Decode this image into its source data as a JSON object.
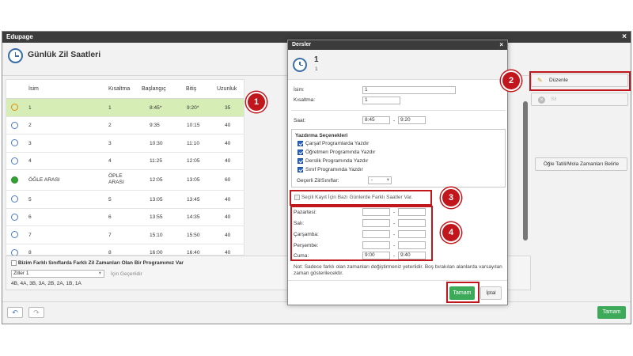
{
  "window": {
    "title": "Edupage",
    "close": "×"
  },
  "header": {
    "title": "Günlük Zil Saatleri"
  },
  "table": {
    "columns": [
      "İsim",
      "Kısaltma",
      "Başlangıç",
      "Bitiş",
      "Uzunluk"
    ],
    "rows": [
      {
        "name": "1",
        "short": "1",
        "start": "8:45*",
        "end": "9:20*",
        "len": "35"
      },
      {
        "name": "2",
        "short": "2",
        "start": "9:35",
        "end": "10:15",
        "len": "40"
      },
      {
        "name": "3",
        "short": "3",
        "start": "10:30",
        "end": "11:10",
        "len": "40"
      },
      {
        "name": "4",
        "short": "4",
        "start": "11:25",
        "end": "12:05",
        "len": "40"
      },
      {
        "name": "ÖĞLE ARASI",
        "short": "ÖPLE ARASI",
        "start": "12:05",
        "end": "13:05",
        "len": "60"
      },
      {
        "name": "5",
        "short": "5",
        "start": "13:05",
        "end": "13:45",
        "len": "40"
      },
      {
        "name": "6",
        "short": "6",
        "start": "13:55",
        "end": "14:35",
        "len": "40"
      },
      {
        "name": "7",
        "short": "7",
        "start": "15:10",
        "end": "15:50",
        "len": "40"
      },
      {
        "name": "8",
        "short": "8",
        "start": "16:00",
        "end": "16:40",
        "len": "40"
      }
    ]
  },
  "bottom_pane": {
    "checkbox_label": "Bizim Farklı Sınıflarda Farklı Zil Zamanları Olan Bir Programımız Var",
    "select_value": "Ziller 1",
    "valid_for": "İçin Geçerlidir",
    "classes": "4B, 4A, 3B, 3A, 2B, 2A, 1B, 1A"
  },
  "right_panel": {
    "edit_label": "Düzenle",
    "delete_label": "Sil",
    "lunch_label": "Öğle Tatili/Mola Zamanları Belirle"
  },
  "footer": {
    "ok_label": "Tamam",
    "undo_icon": "undo-icon",
    "redo_icon": "redo-icon"
  },
  "dialog": {
    "title": "Dersler",
    "close": "×",
    "head_title": "1",
    "head_sub": "1",
    "name_label": "İsim:",
    "name_value": "1",
    "short_label": "Kısaltma:",
    "short_value": "1",
    "time_label": "Saat:",
    "time_start": "8:45",
    "time_end": "9:20",
    "time_sep": "-",
    "print_title": "Yazdırma Seçenekleri",
    "print_options": [
      "Çarşaf Programlarda Yazdır",
      "Öğretmen Programında Yazdır",
      "Derslik Programında Yazdır",
      "Sınıf Programında Yazdır"
    ],
    "valid_label": "Geçerli Zil/Sınıflar:",
    "valid_value": "-",
    "diff_label": "Seçili Kayıt İçin Bazı Günlerde Farklı Saatler Var.",
    "days": [
      {
        "name": "Pazartesi:",
        "start": "",
        "end": ""
      },
      {
        "name": "Salı:",
        "start": "",
        "end": ""
      },
      {
        "name": "Çarşamba:",
        "start": "",
        "end": ""
      },
      {
        "name": "Perşembe:",
        "start": "",
        "end": ""
      },
      {
        "name": "Cuma:",
        "start": "9:00",
        "end": "9:40"
      }
    ],
    "note": "Not: Sadece farklı olan zamanları değiştirmeniz yeterlidir. Boş bırakılan alanlarda varsayılan zaman gösterilecektir.",
    "ok_label": "Tamam",
    "cancel_label": "İptal"
  },
  "callouts": [
    "1",
    "2",
    "3",
    "4"
  ],
  "colors": {
    "accent_red": "#c0161c",
    "selected_row": "#d7edb6",
    "ok_green": "#3daa5a",
    "titlebar": "#3c3c3c"
  }
}
